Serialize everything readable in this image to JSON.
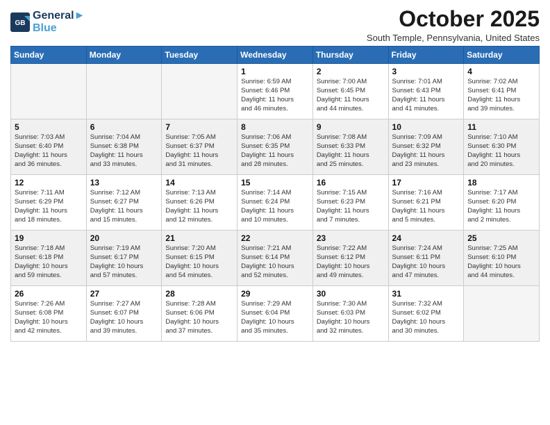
{
  "header": {
    "logo_line1": "General",
    "logo_line2": "Blue",
    "month": "October 2025",
    "location": "South Temple, Pennsylvania, United States"
  },
  "weekdays": [
    "Sunday",
    "Monday",
    "Tuesday",
    "Wednesday",
    "Thursday",
    "Friday",
    "Saturday"
  ],
  "weeks": [
    [
      {
        "day": "",
        "info": ""
      },
      {
        "day": "",
        "info": ""
      },
      {
        "day": "",
        "info": ""
      },
      {
        "day": "1",
        "info": "Sunrise: 6:59 AM\nSunset: 6:46 PM\nDaylight: 11 hours\nand 46 minutes."
      },
      {
        "day": "2",
        "info": "Sunrise: 7:00 AM\nSunset: 6:45 PM\nDaylight: 11 hours\nand 44 minutes."
      },
      {
        "day": "3",
        "info": "Sunrise: 7:01 AM\nSunset: 6:43 PM\nDaylight: 11 hours\nand 41 minutes."
      },
      {
        "day": "4",
        "info": "Sunrise: 7:02 AM\nSunset: 6:41 PM\nDaylight: 11 hours\nand 39 minutes."
      }
    ],
    [
      {
        "day": "5",
        "info": "Sunrise: 7:03 AM\nSunset: 6:40 PM\nDaylight: 11 hours\nand 36 minutes."
      },
      {
        "day": "6",
        "info": "Sunrise: 7:04 AM\nSunset: 6:38 PM\nDaylight: 11 hours\nand 33 minutes."
      },
      {
        "day": "7",
        "info": "Sunrise: 7:05 AM\nSunset: 6:37 PM\nDaylight: 11 hours\nand 31 minutes."
      },
      {
        "day": "8",
        "info": "Sunrise: 7:06 AM\nSunset: 6:35 PM\nDaylight: 11 hours\nand 28 minutes."
      },
      {
        "day": "9",
        "info": "Sunrise: 7:08 AM\nSunset: 6:33 PM\nDaylight: 11 hours\nand 25 minutes."
      },
      {
        "day": "10",
        "info": "Sunrise: 7:09 AM\nSunset: 6:32 PM\nDaylight: 11 hours\nand 23 minutes."
      },
      {
        "day": "11",
        "info": "Sunrise: 7:10 AM\nSunset: 6:30 PM\nDaylight: 11 hours\nand 20 minutes."
      }
    ],
    [
      {
        "day": "12",
        "info": "Sunrise: 7:11 AM\nSunset: 6:29 PM\nDaylight: 11 hours\nand 18 minutes."
      },
      {
        "day": "13",
        "info": "Sunrise: 7:12 AM\nSunset: 6:27 PM\nDaylight: 11 hours\nand 15 minutes."
      },
      {
        "day": "14",
        "info": "Sunrise: 7:13 AM\nSunset: 6:26 PM\nDaylight: 11 hours\nand 12 minutes."
      },
      {
        "day": "15",
        "info": "Sunrise: 7:14 AM\nSunset: 6:24 PM\nDaylight: 11 hours\nand 10 minutes."
      },
      {
        "day": "16",
        "info": "Sunrise: 7:15 AM\nSunset: 6:23 PM\nDaylight: 11 hours\nand 7 minutes."
      },
      {
        "day": "17",
        "info": "Sunrise: 7:16 AM\nSunset: 6:21 PM\nDaylight: 11 hours\nand 5 minutes."
      },
      {
        "day": "18",
        "info": "Sunrise: 7:17 AM\nSunset: 6:20 PM\nDaylight: 11 hours\nand 2 minutes."
      }
    ],
    [
      {
        "day": "19",
        "info": "Sunrise: 7:18 AM\nSunset: 6:18 PM\nDaylight: 10 hours\nand 59 minutes."
      },
      {
        "day": "20",
        "info": "Sunrise: 7:19 AM\nSunset: 6:17 PM\nDaylight: 10 hours\nand 57 minutes."
      },
      {
        "day": "21",
        "info": "Sunrise: 7:20 AM\nSunset: 6:15 PM\nDaylight: 10 hours\nand 54 minutes."
      },
      {
        "day": "22",
        "info": "Sunrise: 7:21 AM\nSunset: 6:14 PM\nDaylight: 10 hours\nand 52 minutes."
      },
      {
        "day": "23",
        "info": "Sunrise: 7:22 AM\nSunset: 6:12 PM\nDaylight: 10 hours\nand 49 minutes."
      },
      {
        "day": "24",
        "info": "Sunrise: 7:24 AM\nSunset: 6:11 PM\nDaylight: 10 hours\nand 47 minutes."
      },
      {
        "day": "25",
        "info": "Sunrise: 7:25 AM\nSunset: 6:10 PM\nDaylight: 10 hours\nand 44 minutes."
      }
    ],
    [
      {
        "day": "26",
        "info": "Sunrise: 7:26 AM\nSunset: 6:08 PM\nDaylight: 10 hours\nand 42 minutes."
      },
      {
        "day": "27",
        "info": "Sunrise: 7:27 AM\nSunset: 6:07 PM\nDaylight: 10 hours\nand 39 minutes."
      },
      {
        "day": "28",
        "info": "Sunrise: 7:28 AM\nSunset: 6:06 PM\nDaylight: 10 hours\nand 37 minutes."
      },
      {
        "day": "29",
        "info": "Sunrise: 7:29 AM\nSunset: 6:04 PM\nDaylight: 10 hours\nand 35 minutes."
      },
      {
        "day": "30",
        "info": "Sunrise: 7:30 AM\nSunset: 6:03 PM\nDaylight: 10 hours\nand 32 minutes."
      },
      {
        "day": "31",
        "info": "Sunrise: 7:32 AM\nSunset: 6:02 PM\nDaylight: 10 hours\nand 30 minutes."
      },
      {
        "day": "",
        "info": ""
      }
    ]
  ]
}
